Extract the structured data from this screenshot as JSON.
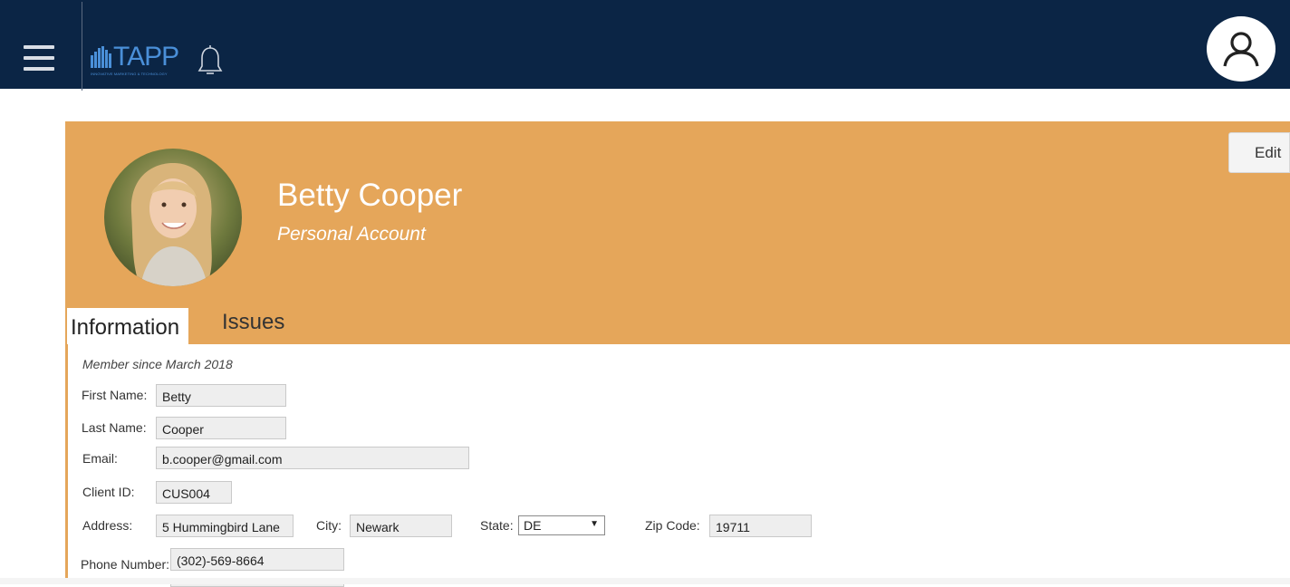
{
  "app": {
    "logo_text": "TAPP",
    "logo_tagline": "INNOVATIVE MARKETING & TECHNOLOGY"
  },
  "icons": {
    "menu": "hamburger-menu-icon",
    "notifications": "bell-icon",
    "account": "user-icon"
  },
  "colors": {
    "topbar": "#0b2545",
    "banner": "#e5a65a",
    "logo": "#4a8fd8"
  },
  "profile": {
    "name": "Betty Cooper",
    "account_type": "Personal Account",
    "edit_label": "Edit"
  },
  "tabs": [
    {
      "label": "Information",
      "active": true
    },
    {
      "label": "Issues",
      "active": false
    }
  ],
  "info": {
    "member_since": "Member since March 2018",
    "first_name": {
      "label": "First Name:",
      "value": "Betty"
    },
    "last_name": {
      "label": "Last Name:",
      "value": "Cooper"
    },
    "email": {
      "label": "Email:",
      "value": "b.cooper@gmail.com"
    },
    "client_id": {
      "label": "Client ID:",
      "value": "CUS004"
    },
    "address": {
      "label": "Address:",
      "value": "5 Hummingbird Lane"
    },
    "city": {
      "label": "City:",
      "value": "Newark"
    },
    "state": {
      "label": "State:",
      "value": "DE"
    },
    "zip": {
      "label": "Zip Code:",
      "value": "19711"
    },
    "phone": {
      "label": "Phone Number:",
      "value": "(302)-569-8664"
    }
  }
}
